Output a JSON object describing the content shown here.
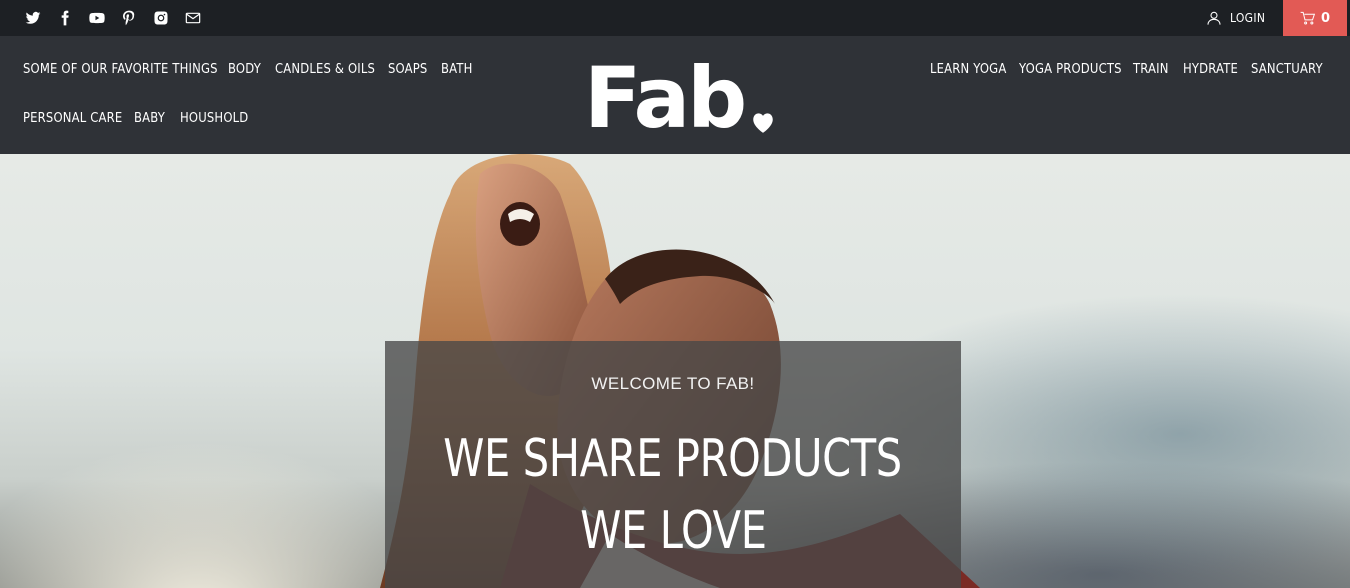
{
  "topbar": {
    "social_icons": [
      "twitter-icon",
      "facebook-icon",
      "youtube-icon",
      "pinterest-icon",
      "instagram-icon",
      "email-icon"
    ],
    "login_label": "LOGIN",
    "cart_count": "0",
    "cart_color": "#e25a55"
  },
  "nav": {
    "left_row1": [
      "SOME OF OUR FAVORITE THINGS",
      "BODY",
      "CANDLES & OILS",
      "SOAPS",
      "BATH"
    ],
    "left_row2": [
      "PERSONAL CARE",
      "BABY",
      "HOUSHOLD"
    ],
    "right": [
      "LEARN YOGA",
      "YOGA PRODUCTS",
      "TRAIN",
      "HYDRATE",
      "SANCTUARY"
    ]
  },
  "logo": {
    "text": "Fab"
  },
  "hero": {
    "welcome": "WELCOME TO FAB!",
    "headline_line1": "WE SHARE PRODUCTS",
    "headline_line2": "WE LOVE"
  }
}
